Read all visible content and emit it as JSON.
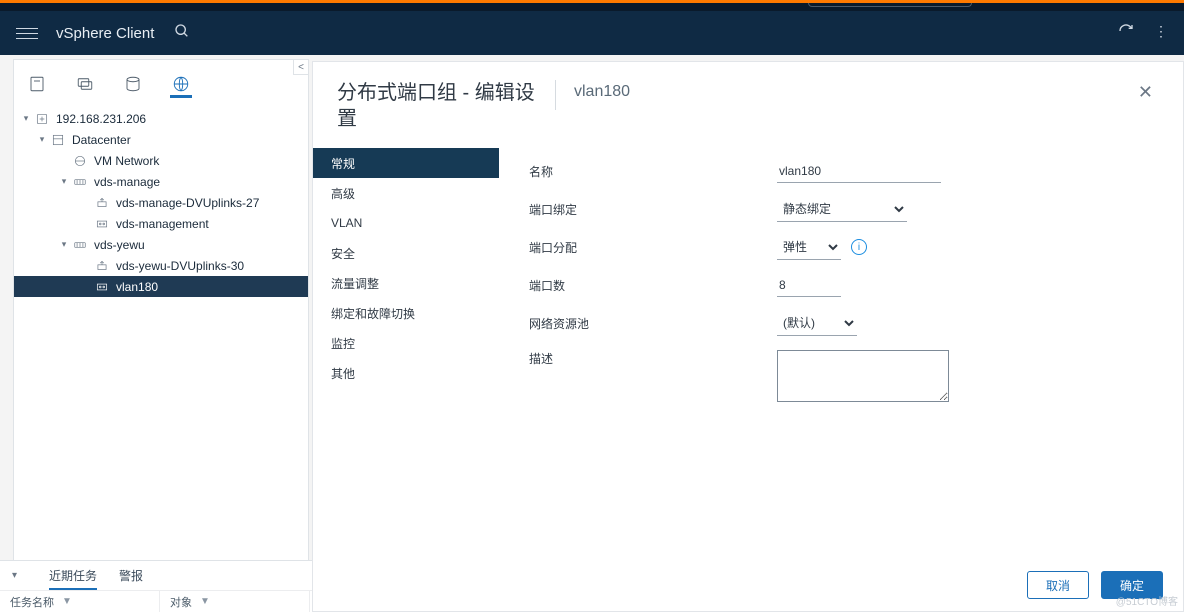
{
  "header": {
    "title": "vSphere Client"
  },
  "tree": {
    "root_ip": "192.168.231.206",
    "datacenter": "Datacenter",
    "vm_network": "VM Network",
    "vds_manage": "vds-manage",
    "vds_manage_uplinks": "vds-manage-DVUplinks-27",
    "vds_management": "vds-management",
    "vds_yewu": "vds-yewu",
    "vds_yewu_uplinks": "vds-yewu-DVUplinks-30",
    "vlan180": "vlan180"
  },
  "tasks": {
    "recent_label": "近期任务",
    "alarms_label": "警报",
    "col_taskname": "任务名称",
    "col_object": "对象"
  },
  "modal": {
    "title": "分布式端口组 - 编辑设置",
    "context": "vlan180",
    "side": {
      "general": "常规",
      "advanced": "高级",
      "vlan": "VLAN",
      "security": "安全",
      "traffic": "流量调整",
      "teaming": "绑定和故障切换",
      "monitoring": "监控",
      "misc": "其他"
    },
    "form": {
      "name_label": "名称",
      "name_value": "vlan180",
      "port_binding_label": "端口绑定",
      "port_binding_value": "静态绑定",
      "port_alloc_label": "端口分配",
      "port_alloc_value": "弹性",
      "port_count_label": "端口数",
      "port_count_value": "8",
      "resource_pool_label": "网络资源池",
      "resource_pool_value": "(默认)",
      "desc_label": "描述",
      "desc_value": ""
    },
    "footer": {
      "cancel": "取消",
      "ok": "确定"
    }
  },
  "watermark": "@51CTO博客"
}
